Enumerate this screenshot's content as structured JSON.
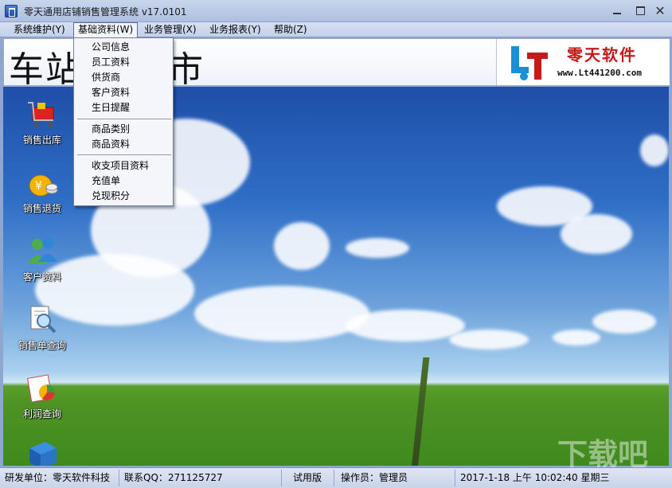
{
  "window": {
    "title": "零天通用店铺销售管理系统  v17.0101",
    "minimize_label": "",
    "maximize_label": "",
    "close_label": "✕"
  },
  "menubar": {
    "items": [
      {
        "label": "系统维护(Y)"
      },
      {
        "label": "基础资料(W)"
      },
      {
        "label": "业务管理(X)"
      },
      {
        "label": "业务报表(Y)"
      },
      {
        "label": "帮助(Z)"
      }
    ]
  },
  "dropdown": {
    "groups": [
      [
        "公司信息",
        "员工资料",
        "供货商",
        "客户资料",
        "生日提醒"
      ],
      [
        "商品类别",
        "商品资料"
      ],
      [
        "收支项目资料",
        "充值单",
        "兑现积分"
      ]
    ]
  },
  "banner": {
    "title": "车站    天超市",
    "logo_name": "零天软件",
    "logo_url": "www.Lt441200.com"
  },
  "desktop_icons": [
    {
      "label": "销售出库",
      "icon": "cart-icon"
    },
    {
      "label": "销售退货",
      "icon": "money-bag-icon"
    },
    {
      "label": "客户资料",
      "icon": "users-icon"
    },
    {
      "label": "销售单查询",
      "icon": "search-document-icon"
    },
    {
      "label": "利润查询",
      "icon": "pie-chart-icon"
    },
    {
      "label": "",
      "icon": "book-icon"
    }
  ],
  "statusbar": {
    "developer": "研发单位：零天软件科技",
    "qq": "联系QQ：271125727",
    "edition": "试用版",
    "operator": "操作员：管理员",
    "datetime": "2017-1-18  上午  10:02:40  星期三"
  },
  "watermark": "下载吧",
  "colors": {
    "menu_bg": "#c3d0ea",
    "title_bg": "#aebfe0",
    "logo_red": "#c61b1b"
  }
}
